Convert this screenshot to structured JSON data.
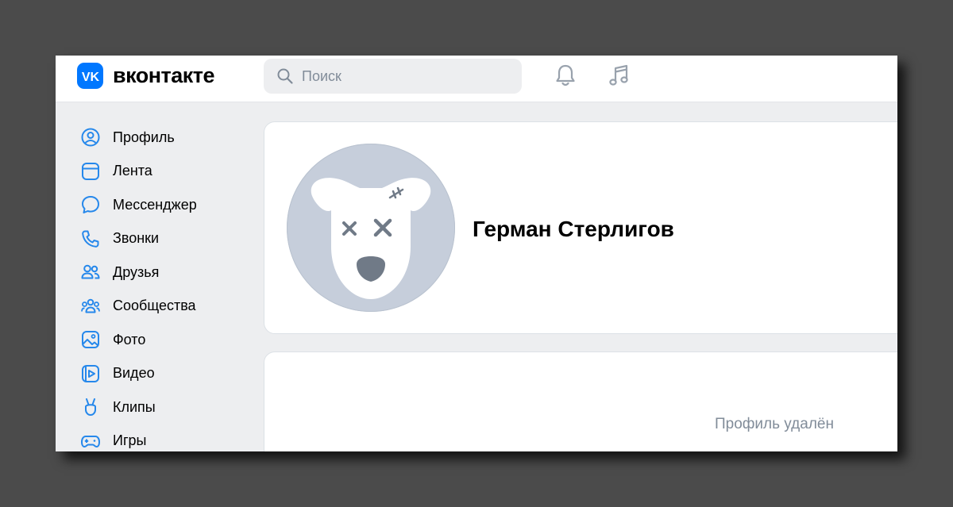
{
  "header": {
    "logo_text": "вконтакте",
    "search_placeholder": "Поиск",
    "icons": [
      "notification-bell-icon",
      "music-note-icon"
    ]
  },
  "sidebar": {
    "items": [
      {
        "label": "Профиль",
        "icon": "profile-icon"
      },
      {
        "label": "Лента",
        "icon": "feed-icon"
      },
      {
        "label": "Мессенджер",
        "icon": "messenger-icon"
      },
      {
        "label": "Звонки",
        "icon": "phone-icon"
      },
      {
        "label": "Друзья",
        "icon": "friends-icon"
      },
      {
        "label": "Сообщества",
        "icon": "communities-icon"
      },
      {
        "label": "Фото",
        "icon": "photo-icon"
      },
      {
        "label": "Видео",
        "icon": "video-icon"
      },
      {
        "label": "Клипы",
        "icon": "clips-icon"
      },
      {
        "label": "Игры",
        "icon": "games-icon"
      }
    ]
  },
  "profile": {
    "name": "Герман Стерлигов",
    "status": "Профиль удалён",
    "avatar_icon": "deactivated-dog-avatar-icon"
  },
  "colors": {
    "accent": "#0077ff",
    "icon_blue": "#2688eb",
    "muted_text": "#818c99",
    "page_bg": "#edeef0"
  }
}
